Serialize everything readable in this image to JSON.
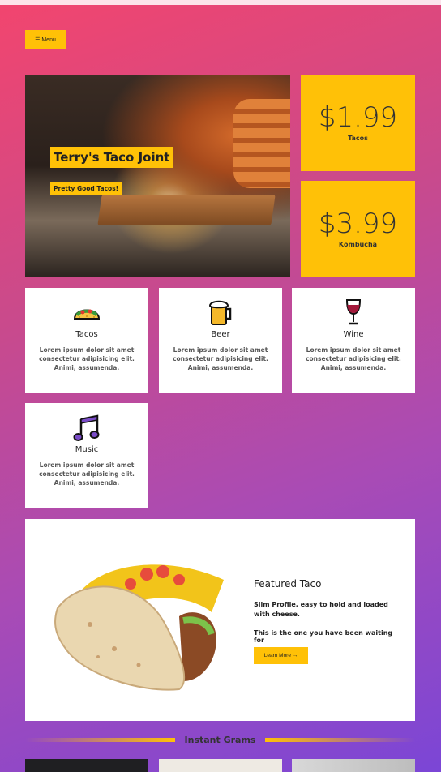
{
  "nav": {
    "menu_label": "☰ Menu"
  },
  "hero": {
    "title": "Terry's Taco Joint",
    "subtitle": "Pretty Good Tacos!"
  },
  "prices": [
    {
      "price": "$1.99",
      "label": "Tacos"
    },
    {
      "price": "$3.99",
      "label": "Kombucha"
    }
  ],
  "features": [
    {
      "title": "Tacos",
      "icon": "taco-icon",
      "text": "Lorem ipsum dolor sit amet consectetur adipisicing elit. Animi, assumenda."
    },
    {
      "title": "Beer",
      "icon": "beer-icon",
      "text": "Lorem ipsum dolor sit amet consectetur adipisicing elit. Animi, assumenda."
    },
    {
      "title": "Wine",
      "icon": "wine-icon",
      "text": "Lorem ipsum dolor sit amet consectetur adipisicing elit. Animi, assumenda."
    },
    {
      "title": "Music",
      "icon": "music-icon",
      "text": "Lorem ipsum dolor sit amet consectetur adipisicing elit. Animi, assumenda."
    }
  ],
  "featured": {
    "title": "Featured Taco",
    "desc1": "Slim Profile, easy to hold and loaded with cheese.",
    "desc2": "This is the one you have been waiting for",
    "button": "Learn More →"
  },
  "grams": {
    "title": "Instant Grams"
  },
  "colors": {
    "accent": "#ffc107",
    "gradient_start": "#f2456e",
    "gradient_end": "#7b46d6"
  }
}
